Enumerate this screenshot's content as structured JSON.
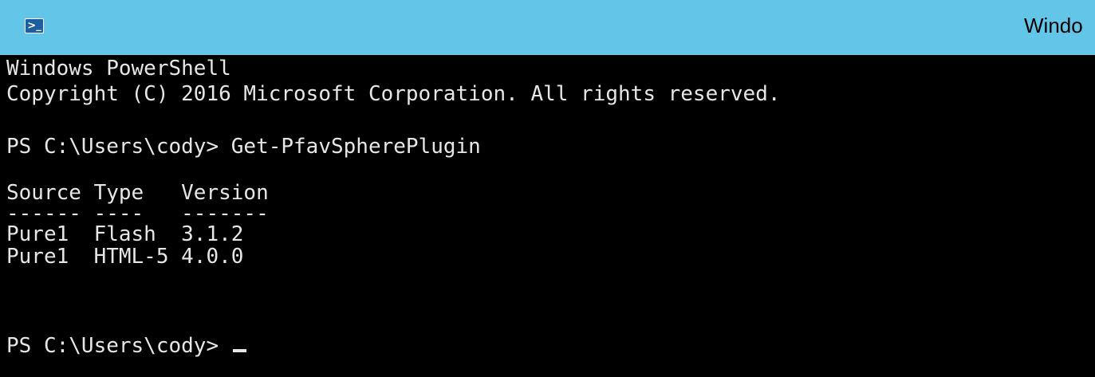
{
  "titlebar": {
    "icon": "powershell-icon",
    "icon_glyph": ">_",
    "title": "Windo"
  },
  "console": {
    "lines": [
      "Windows PowerShell",
      "Copyright (C) 2016 Microsoft Corporation. All rights reserved.",
      "",
      "PS C:\\Users\\cody> Get-PfavSpherePlugin",
      "",
      "Source Type   Version",
      "------ ----   -------",
      "Pure1  Flash  3.1.2",
      "Pure1  HTML-5 4.0.0",
      "",
      "",
      "PS C:\\Users\\cody> "
    ]
  },
  "colors": {
    "titlebar_bg": "#63c5e8",
    "console_bg": "#000000",
    "console_fg": "#e6e6e6"
  }
}
